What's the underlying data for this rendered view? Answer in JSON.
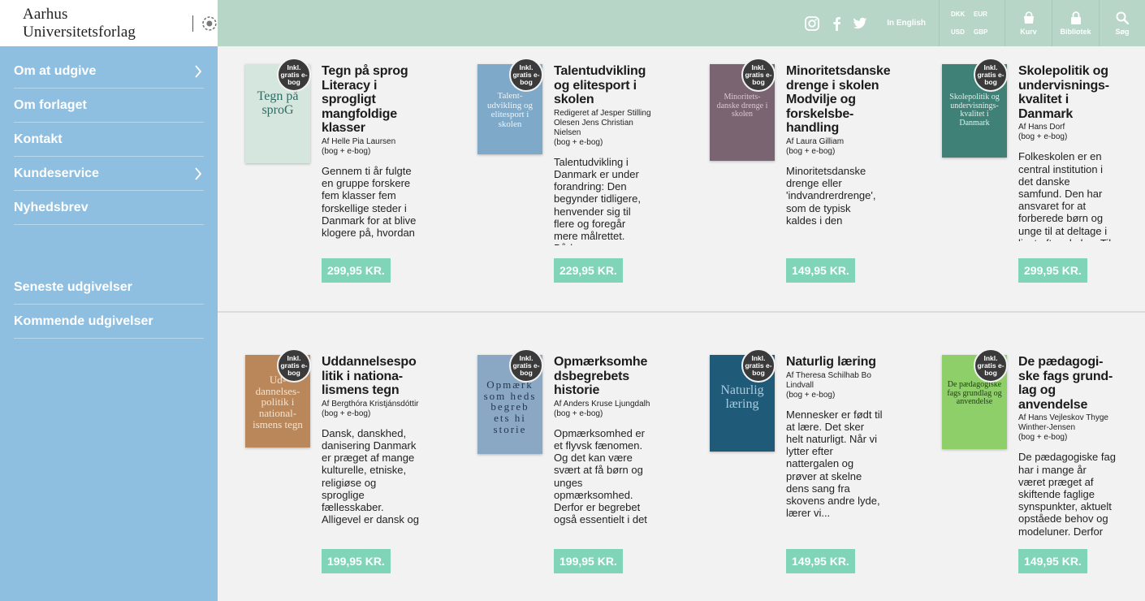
{
  "header": {
    "logo_text": "Aarhus Universitetsforlag",
    "lang_label": "In English",
    "currencies": [
      "DKK",
      "EUR",
      "USD",
      "GBP"
    ],
    "cart_label": "Kurv",
    "library_label": "Bibliotek",
    "search_label": "Søg"
  },
  "sidebar": {
    "items": [
      {
        "label": "Om at udgive",
        "has_submenu": true
      },
      {
        "label": "Om forlaget",
        "has_submenu": false
      },
      {
        "label": "Kontakt",
        "has_submenu": false
      },
      {
        "label": "Kundeservice",
        "has_submenu": true
      },
      {
        "label": "Nyhedsbrev",
        "has_submenu": false
      }
    ],
    "items2": [
      {
        "label": "Seneste udgivelser"
      },
      {
        "label": "Kommende udgivelser"
      }
    ]
  },
  "badge_text": "Inkl. gratis e-bog",
  "books": [
    {
      "title": "Tegn på sprog Literacy i sprogligt mangfoldige klasser",
      "author": "Af Helle Pia Laursen",
      "format": "(bog + e-bog)",
      "description": "Gennem ti år fulgte en gruppe forskere fem klasser fem forskellige steder i Danmark for at blive klogere på, hvordan læse- og",
      "price": "299,95 KR.",
      "cover_text": "Tegn på sproG",
      "cover_color": "#d5e6df"
    },
    {
      "title": "Talentudvikling og elitesport i skolen",
      "author": "Redigeret af Jesper Stilling Olesen Jens Christian Nielsen",
      "format": "(bog + e-bog)",
      "description": "Talentudvikling i Danmark er under forandring: Den begynder tidligere, henvender sig til flere og foregår mere målrettet. Både",
      "price": "229,95 KR.",
      "cover_text": "Talent-udvikling og elitesport i skolen",
      "cover_color": "#7fa9c9"
    },
    {
      "title": "Minoritetsdanske drenge i skolen Modvilje og forskelsbe-handling",
      "author": "Af Laura Gilliam",
      "format": "(bog + e-bog)",
      "description": "Minoritetsdanske drenge eller 'indvandrerdrenge', som de typisk kaldes i den offentlige debat,",
      "price": "149,95 KR.",
      "cover_text": "Minoritets-danske drenge i skolen",
      "cover_color": "#7a6471"
    },
    {
      "title": "Skolepolitik og undervisnings-kvalitet i Danmark",
      "author": "Af Hans Dorf",
      "format": "(bog + e-bog)",
      "description": "Folkeskolen er en central institution i det danske samfund. Den har ansvaret for at forberede børn og unge til at deltage i livet efter skolen. Til",
      "price": "299,95 KR.",
      "cover_text": "Skolepolitik og undervisnings-kvalitet i Danmark",
      "cover_color": "#3f8077"
    },
    {
      "title": "Uddannelsespo litik i nationa-lismens tegn",
      "author": "Af Bergthóra Kristjánsdóttir",
      "format": "(bog + e-bog)",
      "description": "Dansk, danskhed, danisering Danmark er præget af mange kulturelle, etniske, religiøse og sproglige fællesskaber. Alligevel er dansk og",
      "price": "199,95 KR.",
      "cover_text": "Ud-dannelses-politik i national-ismens tegn",
      "cover_color": "#b9875a"
    },
    {
      "title": "Opmærksomhe dsbegrebets historie",
      "author": "Af Anders Kruse Ljungdalh",
      "format": "(bog + e-bog)",
      "description": "Opmærksomhed er et flyvsk fænomen. Og det kan være svært at få børn og unges opmærksomhed. Derfor er begrebet også essentielt i det",
      "price": "199,95 KR.",
      "cover_text": "Opmærk som heds begreb ets hi storie",
      "cover_color": "#8aa7c4"
    },
    {
      "title": "Naturlig læring",
      "author": "Af Theresa Schilhab Bo Lindvall",
      "format": "(bog + e-bog)",
      "description": "Mennesker er født til at lære. Det sker helt naturligt. Når vi lytter efter nattergalen og prøver at skelne dens sang fra skovens andre lyde, lærer vi...",
      "price": "149,95 KR.",
      "cover_text": "Naturlig læring",
      "cover_color": "#1f5a78"
    },
    {
      "title": "De pædagogi-ske fags grund-lag og anvendelse",
      "author": "Af Hans Vejleskov Thyge Winther-Jensen",
      "format": "(bog + e-bog)",
      "description": "De pædagogiske fag har i mange år været præget af skiftende faglige synspunkter, aktuelt opståede behov og modeluner. Derfor",
      "price": "149,95 KR.",
      "cover_text": "De pædagogiske fags grundlag og anvendelse",
      "cover_color": "#8fcf69"
    }
  ]
}
